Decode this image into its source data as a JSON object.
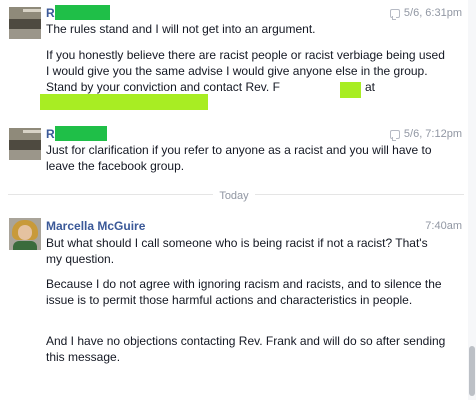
{
  "messages": [
    {
      "author_initial": "R",
      "time": "5/6, 6:31pm",
      "paragraphs": [
        "The rules stand and I will not get into an argument.",
        "If you honestly believe there are racist people or racist verbiage being used I would give you the same advise I would give anyone else in the group.  Stand by your conviction and contact Rev. F",
        "at"
      ]
    },
    {
      "author_initial": "R",
      "time": "5/6, 7:12pm",
      "paragraphs": [
        "Just for clarification if you refer to anyone as a racist and you will have to leave the facebook group."
      ]
    },
    {
      "author": "Marcella McGuire",
      "time": "7:40am",
      "paragraphs": [
        "But what should I call someone who is being racist if not a racist? That's my question.",
        "Because I do not agree with ignoring racism and racists, and to silence the issue is to permit those harmful actions and characteristics in people.",
        "And I have no objections contacting Rev. Frank and will do so after sending this message."
      ]
    }
  ],
  "divider": {
    "label": "Today"
  },
  "icons": {
    "seen": "chat-bubble-icon"
  },
  "colors": {
    "author_link": "#3b5998",
    "redaction_name": "#1fbf48",
    "redaction_contact": "#a8ed23"
  }
}
